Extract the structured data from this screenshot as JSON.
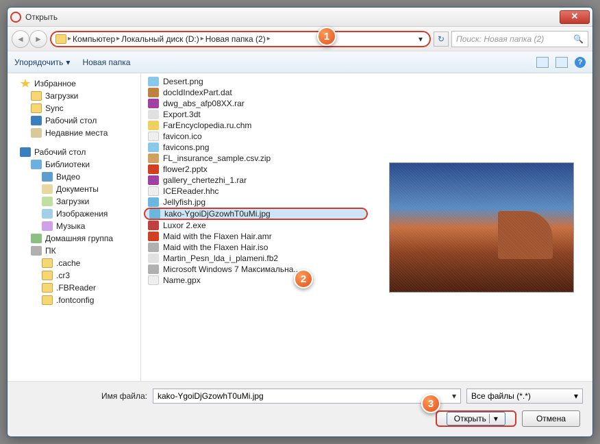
{
  "title": "Открыть",
  "breadcrumb": [
    "Компьютер",
    "Локальный диск (D:)",
    "Новая папка (2)"
  ],
  "search_placeholder": "Поиск: Новая папка (2)",
  "toolbar": {
    "organize": "Упорядочить",
    "newfolder": "Новая папка"
  },
  "sidebar": {
    "favorites": "Избранное",
    "fav_items": [
      "Загрузки",
      "Sync",
      "Рабочий стол",
      "Недавние места"
    ],
    "desktop": "Рабочий стол",
    "libs": "Библиотеки",
    "lib_items": [
      "Видео",
      "Документы",
      "Загрузки",
      "Изображения",
      "Музыка"
    ],
    "homegroup": "Домашняя группа",
    "pc": "ПК",
    "pc_items": [
      ".cache",
      ".cr3",
      ".FBReader",
      ".fontconfig"
    ]
  },
  "files": [
    {
      "n": "Desert.png",
      "i": "fi-img"
    },
    {
      "n": "docIdIndexPart.dat",
      "i": "fi-dat"
    },
    {
      "n": "dwg_abs_afp08XX.rar",
      "i": "fi-rar"
    },
    {
      "n": "Export.3dt",
      "i": "fi-3dt"
    },
    {
      "n": "FarEncyclopedia.ru.chm",
      "i": "fi-chm"
    },
    {
      "n": "favicon.ico",
      "i": "fi-ico"
    },
    {
      "n": "favicons.png",
      "i": "fi-img"
    },
    {
      "n": "FL_insurance_sample.csv.zip",
      "i": "fi-zip"
    },
    {
      "n": "flower2.pptx",
      "i": "fi-pptx"
    },
    {
      "n": "gallery_chertezhi_1.rar",
      "i": "fi-rar"
    },
    {
      "n": "ICEReader.hhc",
      "i": "fi-hhc"
    },
    {
      "n": "Jellyfish.jpg",
      "i": "fi-jpg"
    },
    {
      "n": "kako-YgoiDjGzowhT0uMi.jpg",
      "i": "fi-jpg",
      "sel": true
    },
    {
      "n": "Luxor 2.exe",
      "i": "fi-exe"
    },
    {
      "n": "Maid with the Flaxen Hair.amr",
      "i": "fi-amr"
    },
    {
      "n": "Maid with the Flaxen Hair.iso",
      "i": "fi-iso"
    },
    {
      "n": "Martin_Pesn_lda_i_plameni.fb2",
      "i": "fi-fb2"
    },
    {
      "n": "Microsoft Windows 7 Максимальна...",
      "i": "fi-iso"
    },
    {
      "n": "Name.gpx",
      "i": "fi-gpx"
    }
  ],
  "footer": {
    "filename_label": "Имя файла:",
    "filename_value": "kako-YgoiDjGzowhT0uMi.jpg",
    "filter": "Все файлы (*.*)",
    "open": "Открыть",
    "cancel": "Отмена"
  },
  "callouts": {
    "c1": "1",
    "c2": "2",
    "c3": "3"
  }
}
